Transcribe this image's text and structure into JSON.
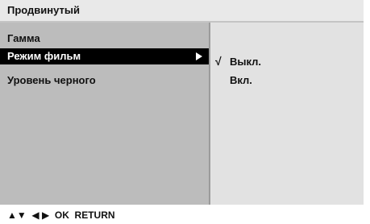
{
  "header": {
    "title": "Продвинутый"
  },
  "menu": {
    "items": [
      {
        "label": "Гамма"
      },
      {
        "label": "Режим фильм"
      },
      {
        "label": "Уровень черного"
      }
    ],
    "selected_index": 1
  },
  "submenu": {
    "check_mark": "√",
    "options": [
      {
        "label": "Выкл.",
        "checked": true
      },
      {
        "label": "Вкл.",
        "checked": false
      }
    ]
  },
  "footer": {
    "hint": "▲▼  ◀ ▶  OK  RETURN"
  },
  "colors": {
    "selected_bg": "#000000",
    "panel_bg": "#bcbcbc",
    "submenu_bg": "#e2e2e2",
    "titlebar_bg": "#e9e9e9"
  }
}
